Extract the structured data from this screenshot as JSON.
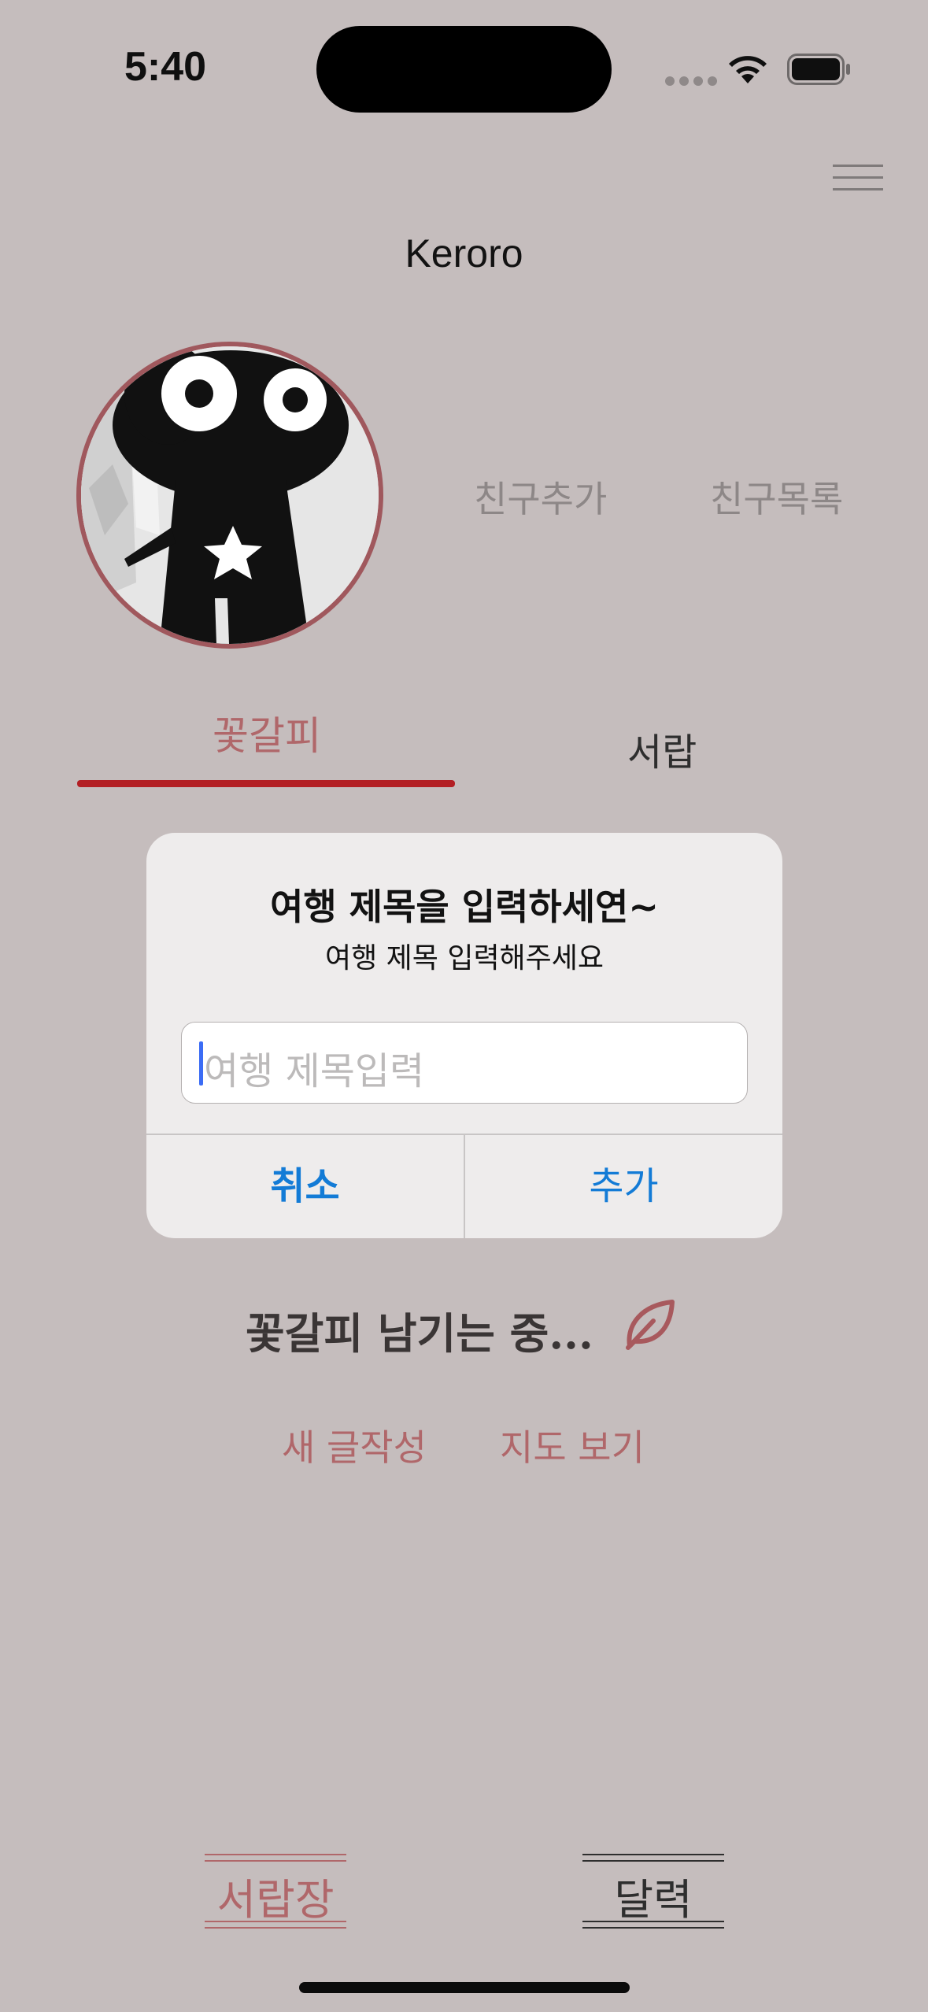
{
  "status_bar": {
    "time": "5:40"
  },
  "header": {
    "title": "Keroro"
  },
  "profile": {
    "add_friend": "친구추가",
    "friend_list": "친구목록"
  },
  "tabs": [
    {
      "label": "꽃갈피",
      "active": true
    },
    {
      "label": "서랍",
      "active": false
    }
  ],
  "main": {
    "status_text": "꽃갈피 남기는 중...",
    "new_post": "새 글작성",
    "view_map": "지도 보기"
  },
  "bottom_nav": [
    {
      "label": "서랍장",
      "active": true
    },
    {
      "label": "달력",
      "active": false
    }
  ],
  "alert": {
    "title": "여행 제목을 입력하세연~",
    "message": "여행 제목 입력해주세요",
    "input_placeholder": "여행 제목입력",
    "input_value": "",
    "cancel": "취소",
    "add": "추가"
  },
  "colors": {
    "background": "#c5bdbd",
    "accent": "#b0676a",
    "tab_underline": "#b31f24",
    "alert_button": "#137bd6"
  }
}
